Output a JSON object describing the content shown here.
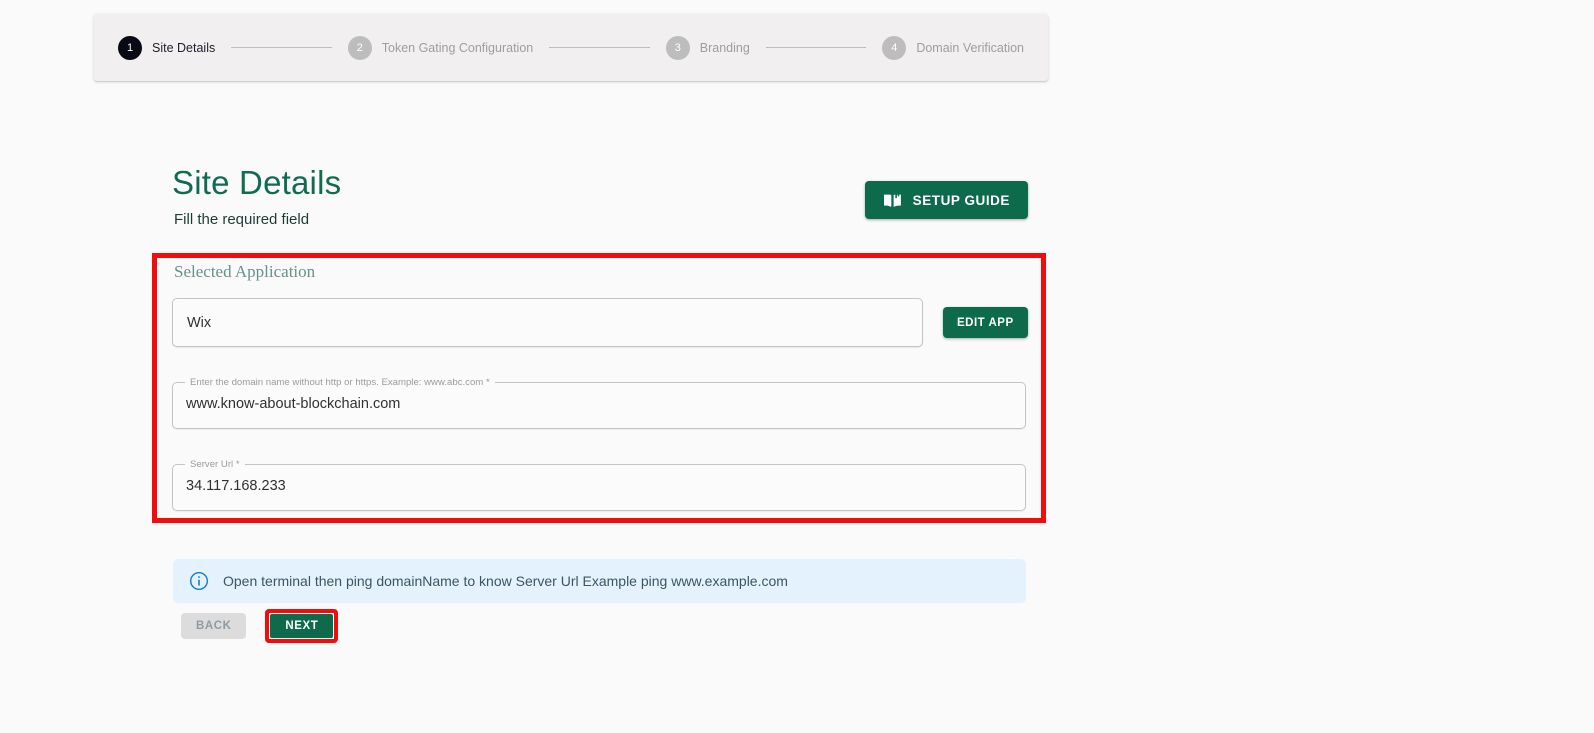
{
  "stepper": {
    "steps": [
      {
        "number": "1",
        "label": "Site Details",
        "active": true
      },
      {
        "number": "2",
        "label": "Token Gating Configuration",
        "active": false
      },
      {
        "number": "3",
        "label": "Branding",
        "active": false
      },
      {
        "number": "4",
        "label": "Domain Verification",
        "active": false
      }
    ]
  },
  "header": {
    "title": "Site Details",
    "subtitle": "Fill the required field",
    "setup_guide_label": "SETUP GUIDE",
    "setup_guide_icon": "menu-book-icon"
  },
  "form": {
    "section_label": "Selected Application",
    "application": {
      "value": "Wix",
      "edit_label": "EDIT APP"
    },
    "fields": [
      {
        "label": "Enter the domain name without http or https. Example: www.abc.com *",
        "value": "www.know-about-blockchain.com",
        "placeholder": "www.abc.com"
      },
      {
        "label": "Server Url *",
        "value": "34.117.168.233",
        "placeholder": "Server Url"
      }
    ]
  },
  "info_alert": {
    "icon": "info-circle-icon",
    "text": "Open terminal then ping domainName to know Server Url Example ping www.example.com"
  },
  "footer": {
    "back_label": "BACK",
    "next_label": "NEXT"
  },
  "colors": {
    "brand_green": "#0d6b4b",
    "title_green": "#116b4f",
    "annotation_red": "#f20d0d",
    "info_blue_bg": "#e3f2fd",
    "info_blue_icon": "#1976d2",
    "page_bg": "#fafafa",
    "stepper_bg": "#f1efef"
  }
}
